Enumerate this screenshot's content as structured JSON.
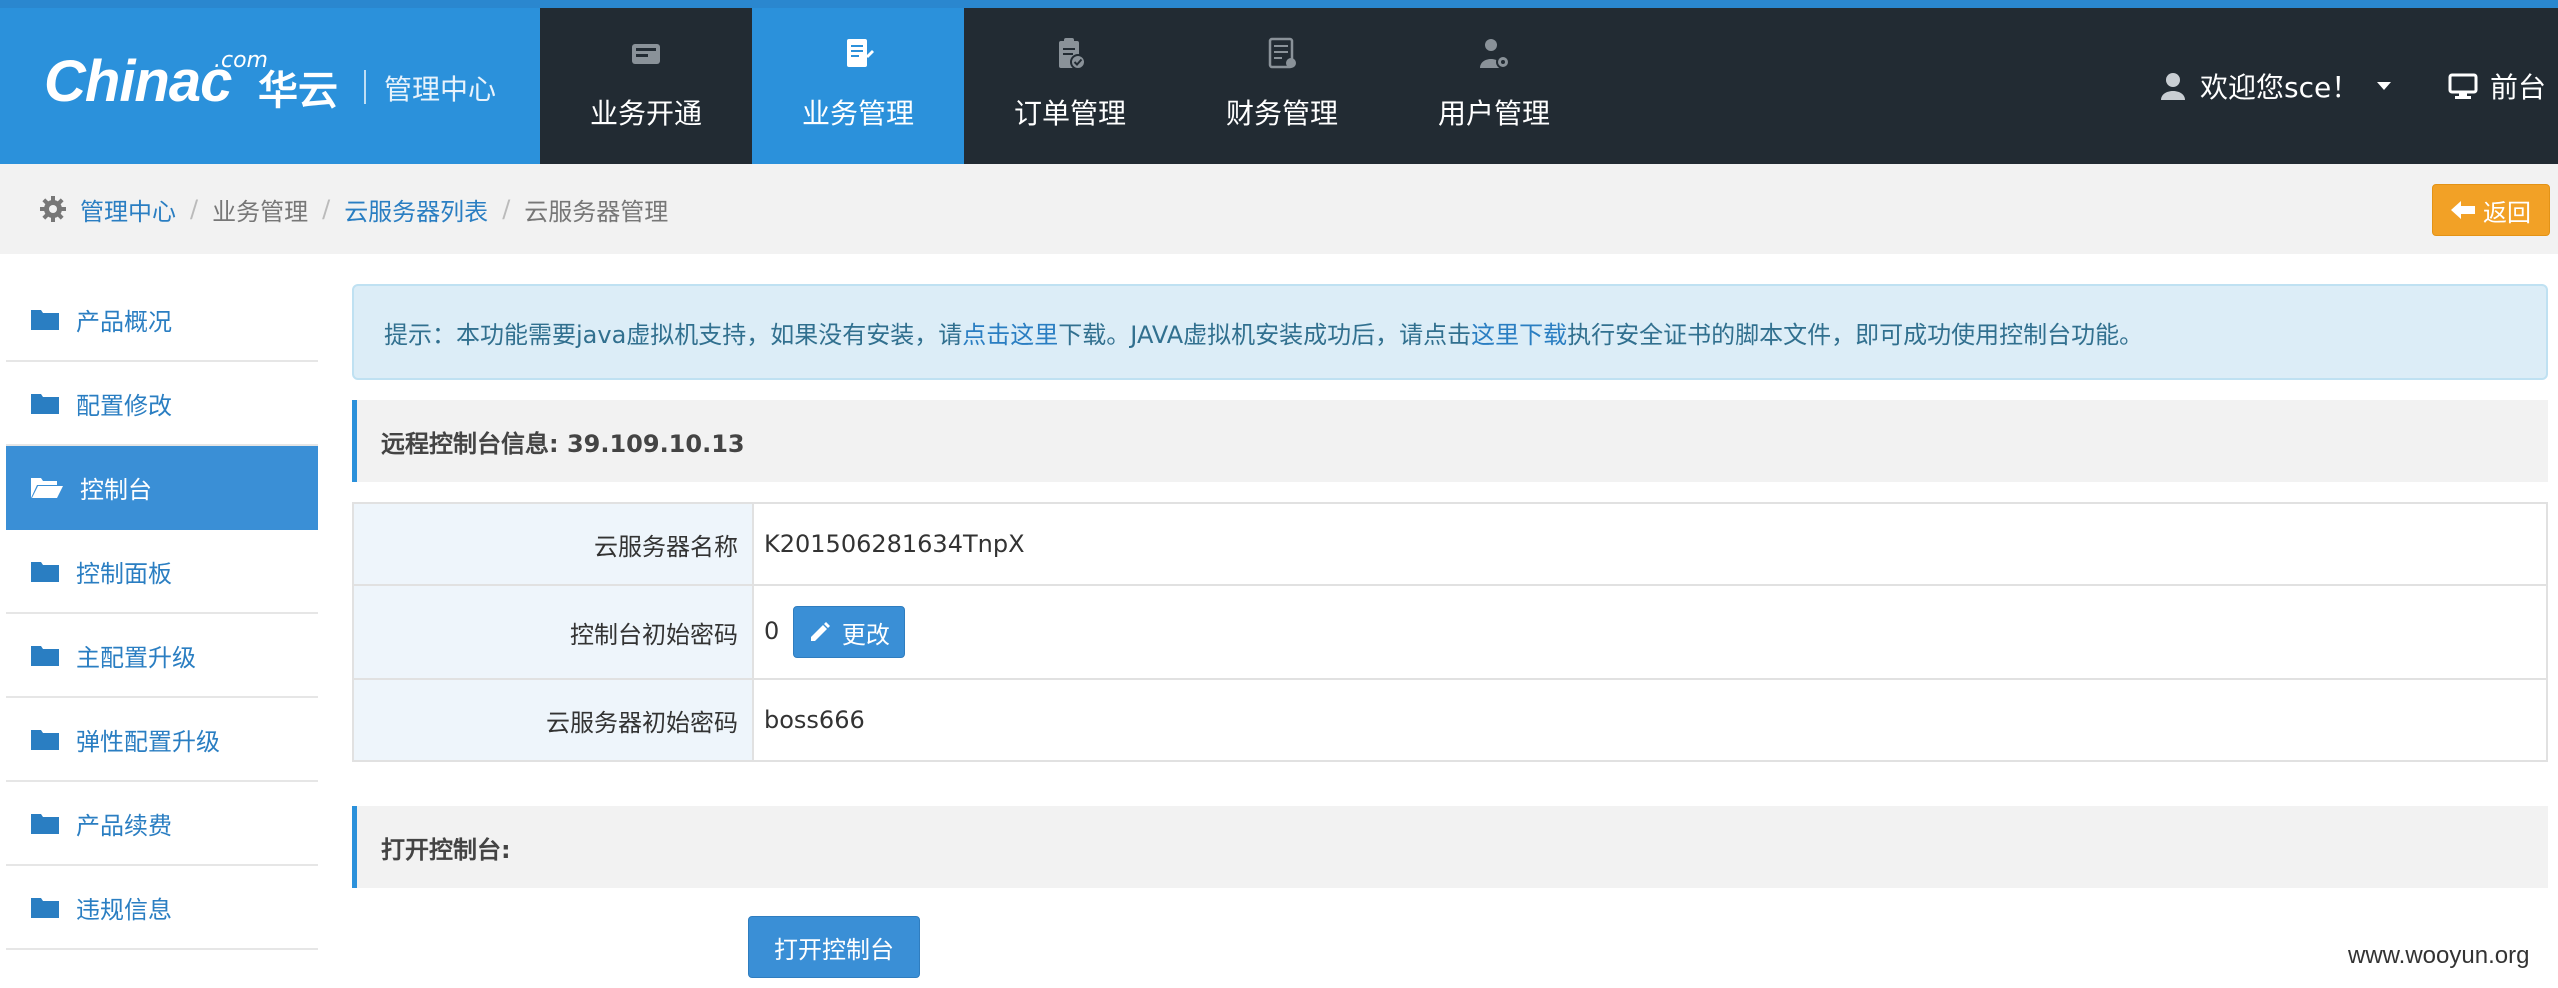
{
  "brand": {
    "logo_text": "Chinac",
    "logo_com": ".com",
    "logo_cn": "华云",
    "subtitle": "管理中心"
  },
  "nav": [
    {
      "label": "业务开通",
      "icon": "register-icon"
    },
    {
      "label": "业务管理",
      "icon": "document-edit-icon",
      "active": true
    },
    {
      "label": "订单管理",
      "icon": "clipboard-check-icon"
    },
    {
      "label": "财务管理",
      "icon": "ledger-icon"
    },
    {
      "label": "用户管理",
      "icon": "user-settings-icon"
    }
  ],
  "user": {
    "greeting": "欢迎您sce！",
    "front_label": "前台"
  },
  "breadcrumb": {
    "home": "管理中心",
    "level2": "业务管理",
    "level3": "云服务器列表",
    "current": "云服务器管理"
  },
  "back_button": "返回",
  "sidebar": [
    {
      "label": "产品概况"
    },
    {
      "label": "配置修改"
    },
    {
      "label": "控制台",
      "active": true
    },
    {
      "label": "控制面板"
    },
    {
      "label": "主配置升级"
    },
    {
      "label": "弹性配置升级"
    },
    {
      "label": "产品续费"
    },
    {
      "label": "违规信息"
    }
  ],
  "notice": {
    "prefix": "提示：本功能需要java虚拟机支持，如果没有安装，请",
    "link1": "点击这里",
    "middle": "下载。JAVA虚拟机安装成功后，请点击",
    "link2": "这里下载",
    "suffix": "执行安全证书的脚本文件，即可成功使用控制台功能。"
  },
  "remote_info": {
    "title": "远程控制台信息: 39.109.10.13"
  },
  "table": {
    "server_name_label": "云服务器名称",
    "server_name_value": "K201506281634TnpX",
    "console_pwd_label": "控制台初始密码",
    "console_pwd_value": "0",
    "edit_button": "更改",
    "server_pwd_label": "云服务器初始密码",
    "server_pwd_value": "boss666"
  },
  "open_console": {
    "title": "打开控制台:",
    "button": "打开控制台"
  },
  "watermark": "www.wooyun.org",
  "colors": {
    "brand_blue": "#2b91db",
    "header_dark": "#222b33",
    "back_orange": "#f2a126"
  }
}
